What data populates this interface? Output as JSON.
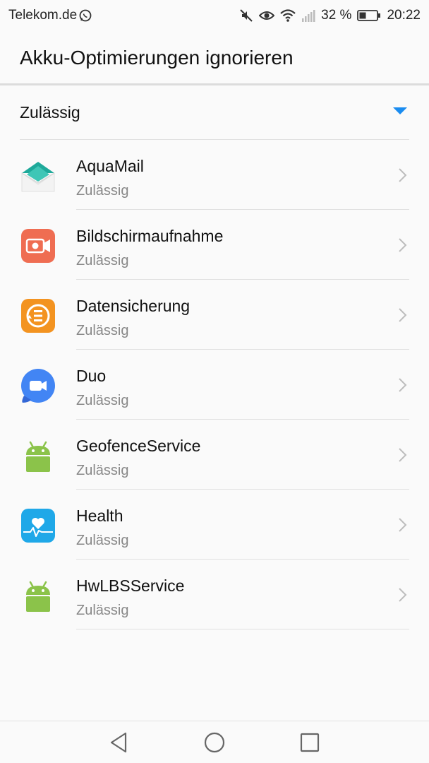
{
  "status_bar": {
    "carrier": "Telekom.de",
    "battery_percent": "32 %",
    "time": "20:22",
    "icons": [
      "whatsapp-icon",
      "mute-icon",
      "eye-icon",
      "wifi-icon",
      "signal-icon",
      "battery-icon"
    ]
  },
  "header": {
    "title": "Akku-Optimierungen ignorieren"
  },
  "filter": {
    "selected": "Zulässig",
    "accent_color": "#1a8cf0"
  },
  "apps": [
    {
      "name": "AquaMail",
      "status": "Zulässig",
      "icon": "aquamail-icon"
    },
    {
      "name": "Bildschirmaufnahme",
      "status": "Zulässig",
      "icon": "screen-recorder-icon"
    },
    {
      "name": "Datensicherung",
      "status": "Zulässig",
      "icon": "backup-icon"
    },
    {
      "name": "Duo",
      "status": "Zulässig",
      "icon": "duo-icon"
    },
    {
      "name": "GeofenceService",
      "status": "Zulässig",
      "icon": "android-icon"
    },
    {
      "name": "Health",
      "status": "Zulässig",
      "icon": "health-icon"
    },
    {
      "name": "HwLBSService",
      "status": "Zulässig",
      "icon": "android-icon"
    }
  ],
  "nav_bar": {
    "buttons": [
      "back",
      "home",
      "recents"
    ]
  }
}
